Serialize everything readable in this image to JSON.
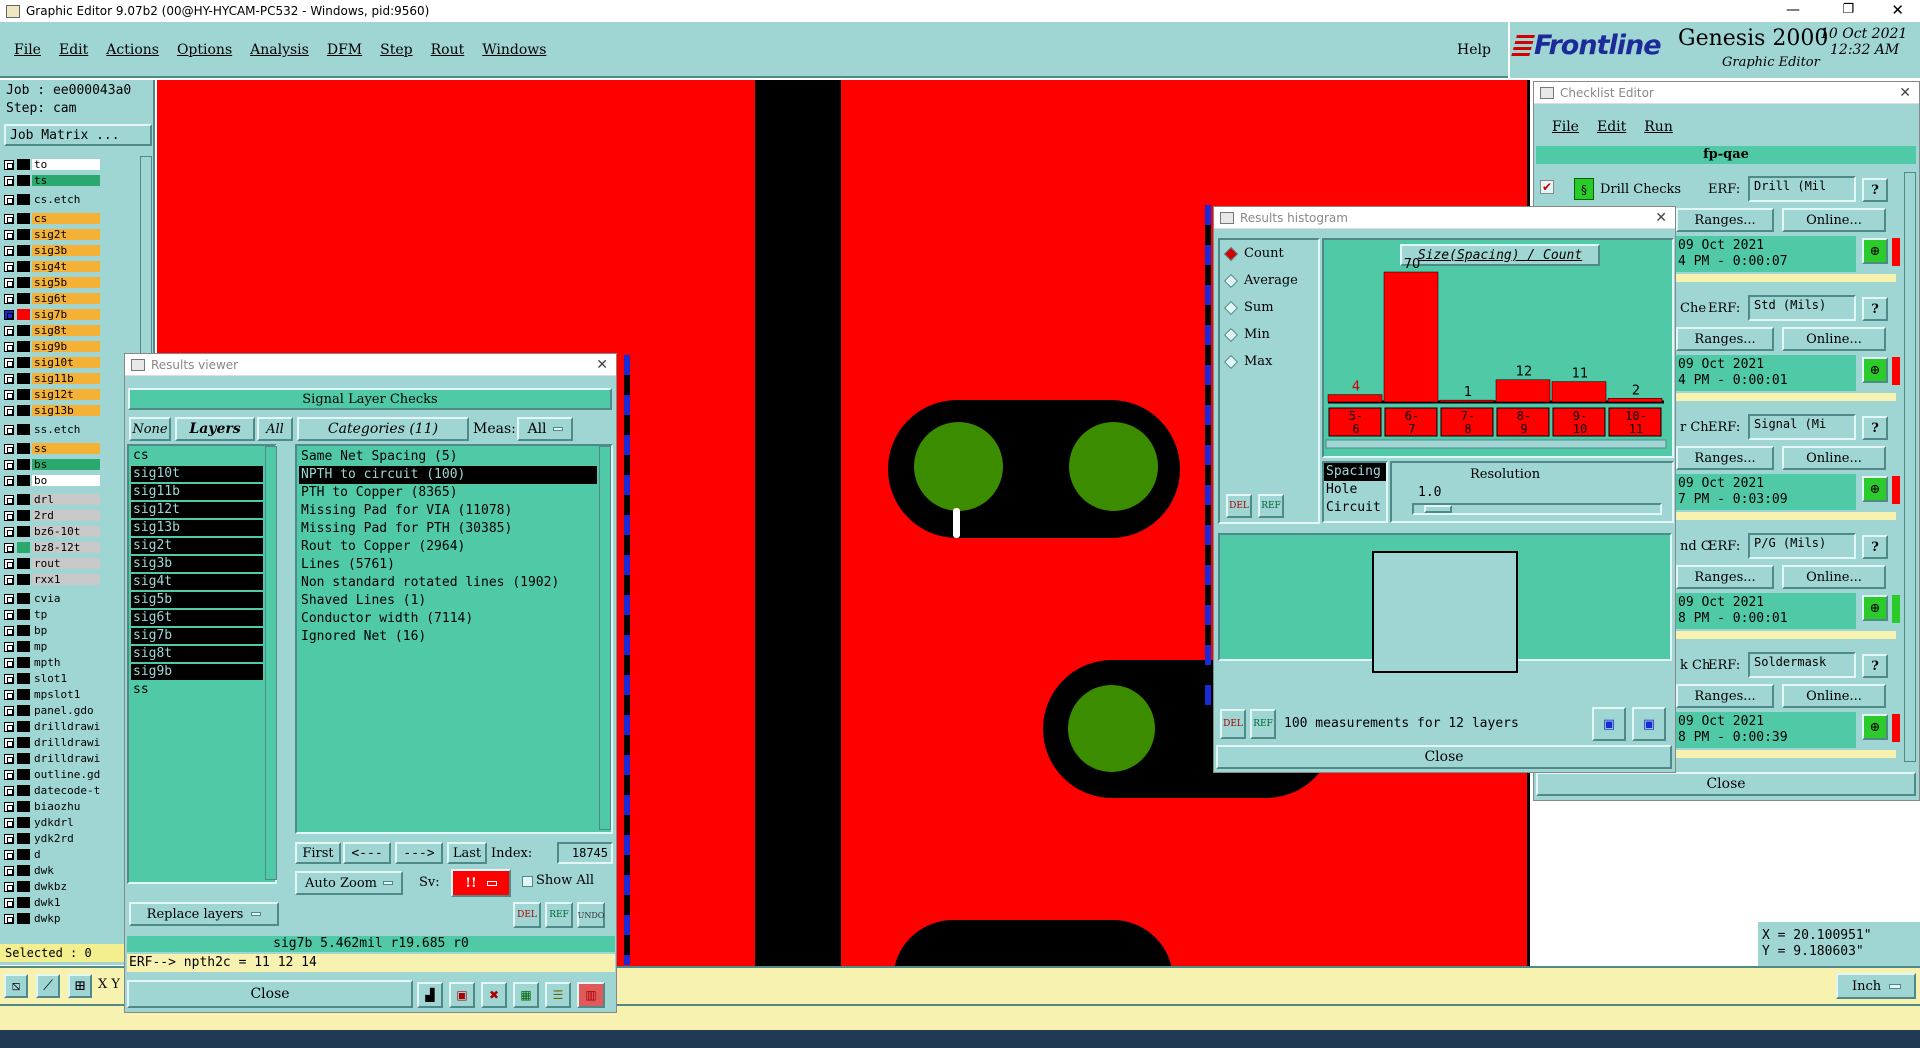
{
  "window": {
    "title": "Graphic Editor 9.07b2 (00@HY-HYCAM-PC532 - Windows, pid:9560)"
  },
  "menu": [
    "File",
    "Edit",
    "Actions",
    "Options",
    "Analysis",
    "DFM",
    "Step",
    "Rout",
    "Windows"
  ],
  "help_label": "Help",
  "brand": {
    "logo": "Frontline",
    "product": "Genesis 2000",
    "subtitle": "Graphic Editor",
    "date": "10 Oct 2021",
    "time": "12:32 AM"
  },
  "left": {
    "job": "Job : ee000043a0",
    "step": "Step: cam",
    "job_matrix": "Job Matrix ...",
    "selected": "Selected : 0",
    "layers": [
      {
        "name": "to",
        "color": "#ffffff"
      },
      {
        "name": "ts",
        "color": "#2aa86e"
      },
      {
        "name": "cs.etch",
        "color": "#9fd6d4",
        "gap": true
      },
      {
        "name": "cs",
        "color": "#f5b136",
        "gap": true
      },
      {
        "name": "sig2t",
        "color": "#f5b136"
      },
      {
        "name": "sig3b",
        "color": "#f5b136"
      },
      {
        "name": "sig4t",
        "color": "#f5b136"
      },
      {
        "name": "sig5b",
        "color": "#f5b136"
      },
      {
        "name": "sig6t",
        "color": "#f5b136"
      },
      {
        "name": "sig7b",
        "color": "#f5b136",
        "active": true
      },
      {
        "name": "sig8t",
        "color": "#f5b136"
      },
      {
        "name": "sig9b",
        "color": "#f5b136"
      },
      {
        "name": "sig10t",
        "color": "#f5b136"
      },
      {
        "name": "sig11b",
        "color": "#f5b136"
      },
      {
        "name": "sig12t",
        "color": "#f5b136"
      },
      {
        "name": "sig13b",
        "color": "#f5b136"
      },
      {
        "name": "ss.etch",
        "color": "#9fd6d4",
        "gap": true
      },
      {
        "name": "ss",
        "color": "#f5b136",
        "gap": true
      },
      {
        "name": "bs",
        "color": "#2aa86e"
      },
      {
        "name": "bo",
        "color": "#ffffff"
      },
      {
        "name": "drl",
        "color": "#c8c8c8",
        "gap": true
      },
      {
        "name": "2rd",
        "color": "#c8c8c8"
      },
      {
        "name": "bz6-10t",
        "color": "#c8c8c8"
      },
      {
        "name": "bz8-12t",
        "color": "#c8c8c8",
        "mark": true
      },
      {
        "name": "rout",
        "color": "#c8c8c8"
      },
      {
        "name": "rxx1",
        "color": "#c8c8c8"
      },
      {
        "name": "cvia",
        "color": "#9fd6d4",
        "gap": true
      },
      {
        "name": "tp",
        "color": "#9fd6d4"
      },
      {
        "name": "bp",
        "color": "#9fd6d4"
      },
      {
        "name": "mp",
        "color": "#9fd6d4"
      },
      {
        "name": "mpth",
        "color": "#9fd6d4"
      },
      {
        "name": "slot1",
        "color": "#9fd6d4"
      },
      {
        "name": "mpslot1",
        "color": "#9fd6d4"
      },
      {
        "name": "panel.gdo",
        "color": "#9fd6d4"
      },
      {
        "name": "drilldrawing",
        "color": "#9fd6d4"
      },
      {
        "name": "drilldrawing",
        "color": "#9fd6d4"
      },
      {
        "name": "drilldrawing",
        "color": "#9fd6d4"
      },
      {
        "name": "outline.gdo",
        "color": "#9fd6d4"
      },
      {
        "name": "datecode-to",
        "color": "#9fd6d4"
      },
      {
        "name": "biaozhu",
        "color": "#9fd6d4"
      },
      {
        "name": "ydkdrl",
        "color": "#9fd6d4"
      },
      {
        "name": "ydk2rd",
        "color": "#9fd6d4"
      },
      {
        "name": "d",
        "color": "#9fd6d4"
      },
      {
        "name": "dwk",
        "color": "#9fd6d4"
      },
      {
        "name": "dwkbz",
        "color": "#9fd6d4"
      },
      {
        "name": "dwk1",
        "color": "#9fd6d4"
      },
      {
        "name": "dwkp",
        "color": "#9fd6d4"
      }
    ]
  },
  "results_viewer": {
    "title": "Results viewer",
    "header": "Signal Layer Checks",
    "none_btn": "None",
    "layers_btn": "Layers",
    "all_btn": "All",
    "categories_btn": "Categories (11)",
    "meas_label": "Meas:",
    "meas_value": "All",
    "layers": [
      "cs",
      "sig10t",
      "sig11b",
      "sig12t",
      "sig13b",
      "sig2t",
      "sig3b",
      "sig4t",
      "sig5b",
      "sig6t",
      "sig7b",
      "sig8t",
      "sig9b",
      "ss"
    ],
    "categories": [
      "Same Net Spacing (5)",
      "NPTH to circuit (100)",
      "PTH to Copper (8365)",
      "Missing Pad for VIA (11078)",
      "Missing Pad for PTH (30385)",
      "Rout to Copper (2964)",
      "Lines (5761)",
      "Non standard rotated lines (1902)",
      "Shaved Lines (1)",
      "Conductor width (7114)",
      "Ignored Net (16)"
    ],
    "first": "First",
    "prev": "<---",
    "next": "--->",
    "last": "Last",
    "index_label": "Index:",
    "index_value": "18745",
    "replace_layers": "Replace layers",
    "auto_zoom": "Auto Zoom",
    "sv_label": "Sv:",
    "sv_value": "!!",
    "show_all": "Show All",
    "status": "sig7b 5.462mil  r19.685  r0",
    "erf_line": "ERF--> npth2c = 11 12 14",
    "close": "Close"
  },
  "histogram": {
    "title": "Results histogram",
    "options": [
      "Count",
      "Average",
      "Sum",
      "Min",
      "Max"
    ],
    "chart_title": "Size(Spacing) / Count",
    "resolution_label": "Resolution",
    "resolution_value": "1.0",
    "types": [
      "Spacing",
      "Hole",
      "Circuit"
    ],
    "measurements": "100 measurements for 12 layers",
    "close": "Close"
  },
  "chart_data": {
    "type": "bar",
    "title": "Size(Spacing) / Count",
    "categories": [
      "5-6",
      "6-7",
      "7-8",
      "8-9",
      "9-10",
      "10-11"
    ],
    "values": [
      4,
      70,
      1,
      12,
      11,
      2
    ],
    "bar_color": "#fe0000"
  },
  "checklist": {
    "title": "Checklist Editor",
    "menu": [
      "File",
      "Edit",
      "Run"
    ],
    "name": "fp-qae",
    "first_check": "Drill Checks",
    "rows": [
      {
        "label": "",
        "erf": "Drill (Mil",
        "date": "09 Oct 2021",
        "time": "4 PM - 0:00:07"
      },
      {
        "label": "Che",
        "erf": "Std (Mils)",
        "date": "09 Oct 2021",
        "time": "4 PM - 0:00:01"
      },
      {
        "label": "r Ch",
        "erf": "Signal (Mi",
        "date": "09 Oct 2021",
        "time": "7 PM - 0:03:09"
      },
      {
        "label": "nd C",
        "erf": "P/G (Mils)",
        "date": "09 Oct 2021",
        "time": "8 PM - 0:00:01"
      },
      {
        "label": "k Ch",
        "erf": "Soldermask",
        "date": "09 Oct 2021",
        "time": "8 PM - 0:00:39"
      }
    ],
    "erf_label": "ERF:",
    "ranges": "Ranges...",
    "online": "Online...",
    "close": "Close"
  },
  "coords": {
    "x": "X = 20.100951\"",
    "y": "Y = 9.180603\""
  },
  "units": "Inch",
  "xy_label": "X Y"
}
